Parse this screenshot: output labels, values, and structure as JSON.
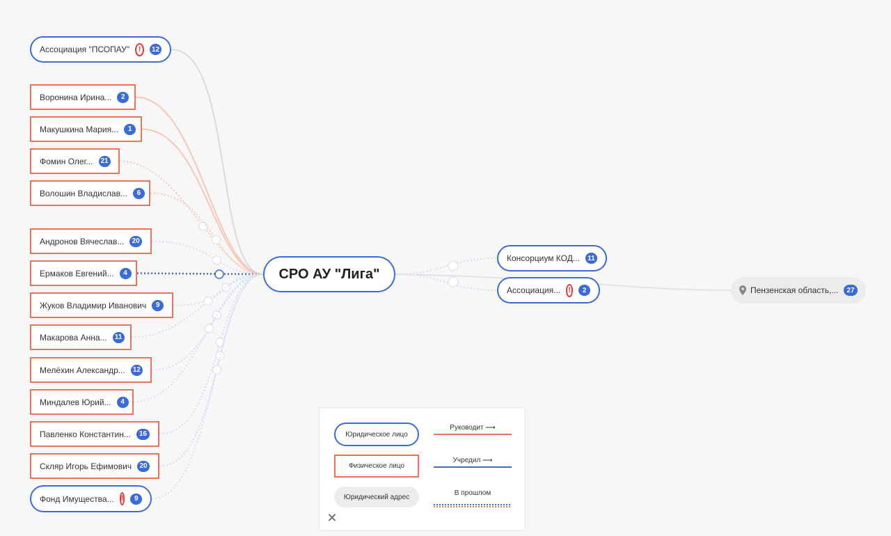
{
  "center": {
    "label": "СРО АУ \"Лига\""
  },
  "left_nodes": [
    {
      "type": "legal",
      "label": "Ассоциация \"ПСОПАУ\"",
      "warning": true,
      "count": "12"
    },
    {
      "type": "person",
      "label": "Воронина Ирина...",
      "warning": false,
      "count": "2"
    },
    {
      "type": "person",
      "label": "Макушкина Мария...",
      "warning": false,
      "count": "1"
    },
    {
      "type": "person",
      "label": "Фомин Олег...",
      "warning": false,
      "count": "21"
    },
    {
      "type": "person",
      "label": "Волошин Владислав...",
      "warning": false,
      "count": "6"
    },
    {
      "type": "person",
      "label": "Андронов Вячеслав...",
      "warning": false,
      "count": "20"
    },
    {
      "type": "person",
      "label": "Ермаков Евгений...",
      "warning": false,
      "count": "4"
    },
    {
      "type": "person",
      "label": "Жуков Владимир Иванович",
      "warning": false,
      "count": "9"
    },
    {
      "type": "person",
      "label": "Макарова Анна...",
      "warning": false,
      "count": "11"
    },
    {
      "type": "person",
      "label": "Мелёхин Александр...",
      "warning": false,
      "count": "12"
    },
    {
      "type": "person",
      "label": "Миндалев Юрий...",
      "warning": false,
      "count": "4"
    },
    {
      "type": "person",
      "label": "Павленко Константин...",
      "warning": false,
      "count": "16"
    },
    {
      "type": "person",
      "label": "Скляр Игорь Ефимович",
      "warning": false,
      "count": "20"
    },
    {
      "type": "legal",
      "label": "Фонд Имущества...",
      "warning": true,
      "count": "9"
    }
  ],
  "right_nodes": [
    {
      "type": "legal",
      "label": "Консорциум КОД...",
      "warning": false,
      "count": "11"
    },
    {
      "type": "legal",
      "label": "Ассоциация...",
      "warning": true,
      "count": "2"
    }
  ],
  "address_node": {
    "label": "Пензенская область,...",
    "count": "27",
    "icon": "map-pin-icon"
  },
  "legend": {
    "legal_entity": "Юридическое лицо",
    "individual": "Физическое лицо",
    "legal_address": "Юридический адрес",
    "manages": "Руководит ⟶",
    "founded": "Учредил ⟶",
    "past": "В прошлом",
    "close_icon": "close-icon"
  },
  "colors": {
    "legal_border": "#3a6bd8",
    "person_border": "#e8735a",
    "badge_bg": "#3a6bd8",
    "warning": "#e53935",
    "address_bg": "#ececee"
  }
}
